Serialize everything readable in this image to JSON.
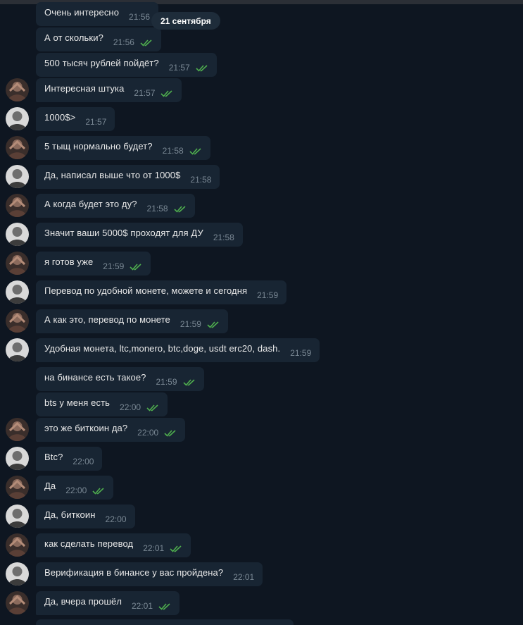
{
  "date_pill": "21 сентября",
  "colors": {
    "background": "#0e1621",
    "bubble": "#182533",
    "text": "#e9e9e9",
    "time": "#7a8894",
    "read_ticks": "#4fae4e"
  },
  "messages": [
    {
      "text": "Очень интересно",
      "time": "21:56",
      "ticks": false,
      "avatar": null
    },
    {
      "text": "А от скольки?",
      "time": "21:56",
      "ticks": true,
      "avatar": null
    },
    {
      "text": "500 тысяч рублей пойдёт?",
      "time": "21:57",
      "ticks": true,
      "avatar": null
    },
    {
      "text": "Интересная штука",
      "time": "21:57",
      "ticks": true,
      "avatar": "self-avatar"
    },
    {
      "text": "1000$>",
      "time": "21:57",
      "ticks": false,
      "avatar": "contact-avatar"
    },
    {
      "text": "5 тыщ нормально будет?",
      "time": "21:58",
      "ticks": true,
      "avatar": "self-avatar"
    },
    {
      "text": "Да, написал выше что от 1000$",
      "time": "21:58",
      "ticks": false,
      "avatar": "contact-avatar"
    },
    {
      "text": "А когда будет это ду?",
      "time": "21:58",
      "ticks": true,
      "avatar": "self-avatar"
    },
    {
      "text": "Значит ваши 5000$ проходят для ДУ",
      "time": "21:58",
      "ticks": false,
      "avatar": "contact-avatar"
    },
    {
      "text": "я готов уже",
      "time": "21:59",
      "ticks": true,
      "avatar": "self-avatar"
    },
    {
      "text": "Перевод по удобной монете, можете и сегодня",
      "time": "21:59",
      "ticks": false,
      "avatar": "contact-avatar"
    },
    {
      "text": "А как это, перевод по монете",
      "time": "21:59",
      "ticks": true,
      "avatar": "self-avatar"
    },
    {
      "text": "Удобная монета, ltc,monero, btc,doge, usdt erc20, dash.",
      "time": "21:59",
      "ticks": false,
      "avatar": "contact-avatar"
    },
    {
      "text": "на бинансе есть такое?",
      "time": "21:59",
      "ticks": true,
      "avatar": null
    },
    {
      "text": "bts у меня есть",
      "time": "22:00",
      "ticks": true,
      "avatar": null
    },
    {
      "text": "это же биткоин да?",
      "time": "22:00",
      "ticks": true,
      "avatar": "self-avatar"
    },
    {
      "text": "Btc?",
      "time": "22:00",
      "ticks": false,
      "avatar": "contact-avatar"
    },
    {
      "text": "Да",
      "time": "22:00",
      "ticks": true,
      "avatar": "self-avatar"
    },
    {
      "text": "Да, биткоин",
      "time": "22:00",
      "ticks": false,
      "avatar": "contact-avatar"
    },
    {
      "text": "как сделать перевод",
      "time": "22:01",
      "ticks": true,
      "avatar": "self-avatar"
    },
    {
      "text": "Верификация в бинансе у вас пройдена?",
      "time": "22:01",
      "ticks": false,
      "avatar": "contact-avatar"
    },
    {
      "text": "Да, вчера прошёл",
      "time": "22:01",
      "ticks": true,
      "avatar": "self-avatar"
    }
  ]
}
